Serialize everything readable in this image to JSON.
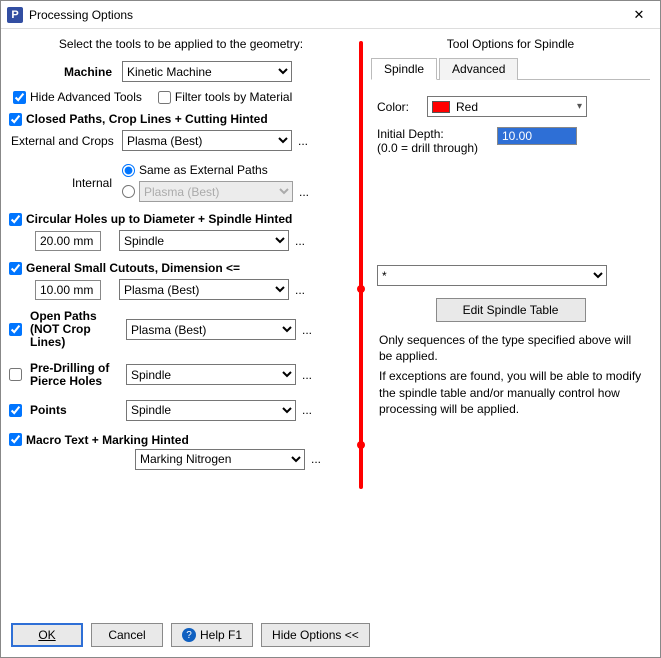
{
  "window": {
    "title": "Processing Options",
    "app_glyph": "P"
  },
  "left": {
    "intro": "Select the tools to be applied to the geometry:",
    "machine_label": "Machine",
    "machine_value": "Kinetic Machine",
    "hide_adv": {
      "label": "Hide Advanced Tools",
      "checked": true
    },
    "filter_mat": {
      "label": "Filter tools by Material",
      "checked": false
    },
    "closed_paths": {
      "label": "Closed Paths,  Crop Lines  +   Cutting Hinted",
      "checked": true
    },
    "external_label": "External and Crops",
    "external_value": "Plasma (Best)",
    "internal_label": "Internal",
    "internal_same": "Same as External Paths",
    "internal_value": "Plasma (Best)",
    "internal_radio": "same",
    "circular": {
      "label": "Circular Holes up to Diameter   +  Spindle Hinted",
      "checked": true,
      "diameter": "20.00 mm",
      "tool": "Spindle"
    },
    "general": {
      "label": "General Small Cutouts, Dimension <=",
      "checked": true,
      "dim": "10.00 mm",
      "tool": "Plasma (Best)"
    },
    "open_paths": {
      "label1": "Open Paths",
      "label2": "(NOT Crop Lines)",
      "checked": true,
      "tool": "Plasma (Best)"
    },
    "predrill": {
      "label1": "Pre-Drilling of",
      "label2": "Pierce Holes",
      "checked": false,
      "tool": "Spindle"
    },
    "points": {
      "label": "Points",
      "checked": true,
      "tool": "Spindle"
    },
    "macrotext": {
      "label": "Macro Text   +  Marking Hinted",
      "checked": true,
      "tool": "Marking Nitrogen"
    },
    "ellipsis": "..."
  },
  "right": {
    "title": "Tool Options for Spindle",
    "tabs": {
      "spindle": "Spindle",
      "advanced": "Advanced",
      "active": "spindle"
    },
    "color_label": "Color:",
    "color_name": "Red",
    "depth_label": "Initial Depth:",
    "depth_sub": "(0.0 = drill through)",
    "depth_value": "10.00",
    "filter_value": "*",
    "edit_btn": "Edit Spindle Table",
    "info1": "Only sequences of the type specified above will be applied.",
    "info2": " If exceptions are found, you will be able to modify the spindle table and/or manually control how processing will be applied."
  },
  "buttons": {
    "ok": "OK",
    "cancel": "Cancel",
    "help": "Help F1",
    "hide": "Hide Options <<"
  }
}
